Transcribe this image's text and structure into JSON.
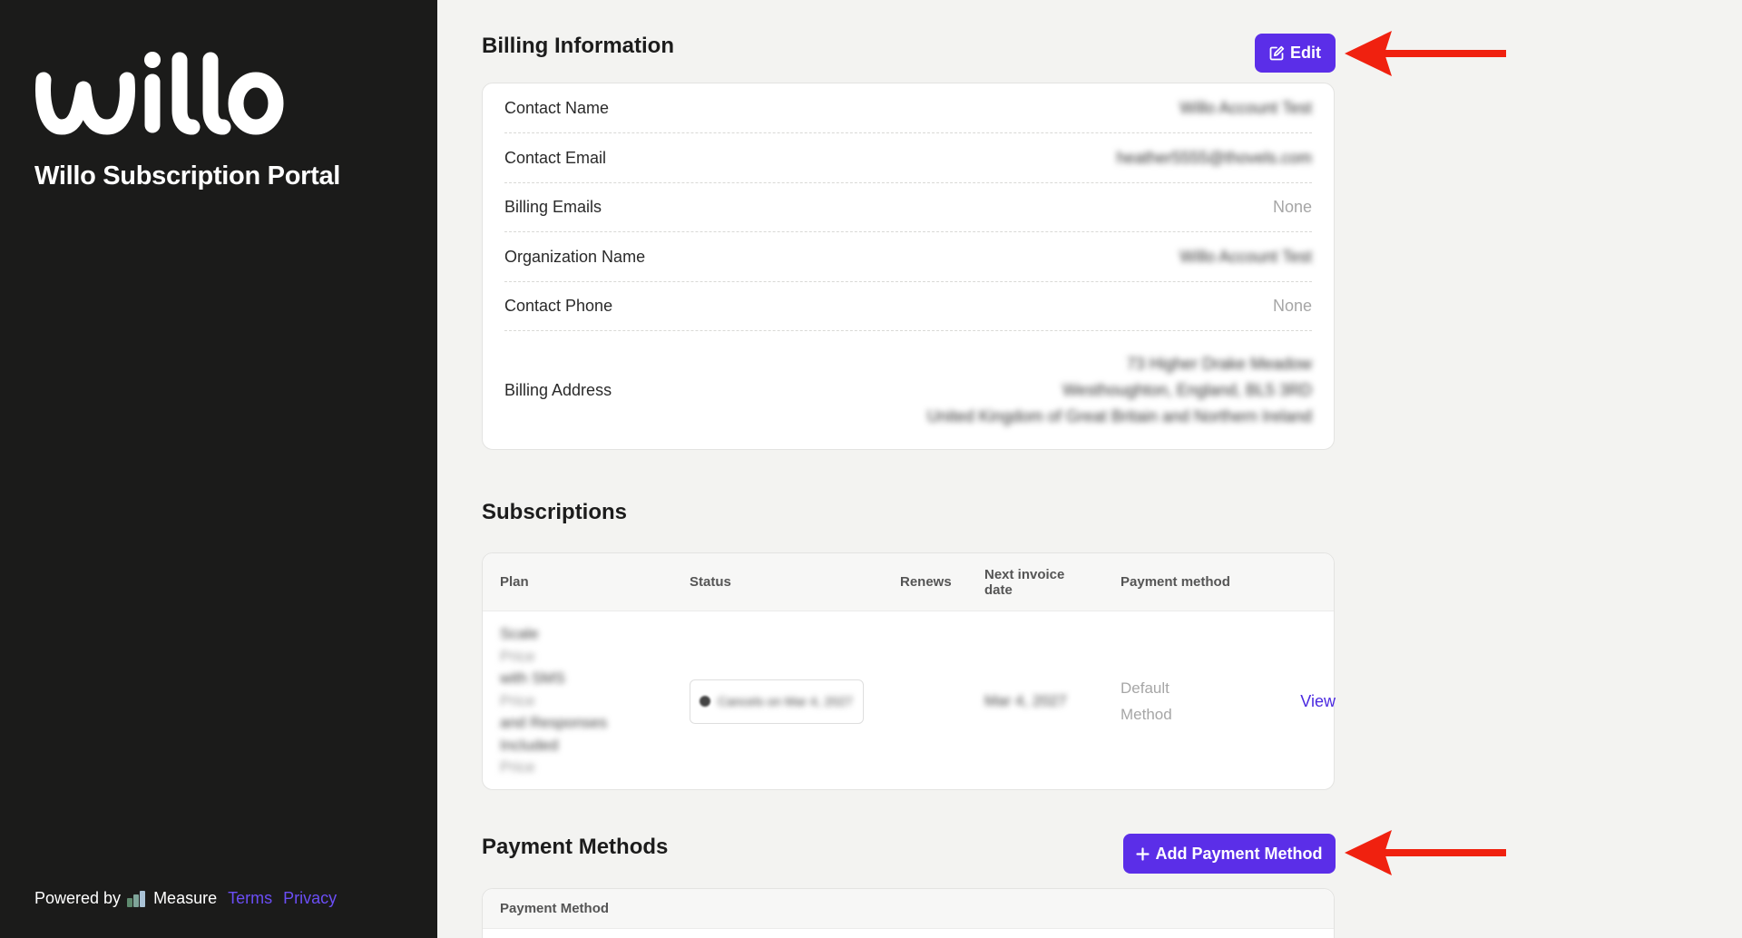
{
  "sidebar": {
    "logo_text": "willo",
    "portal_title": "Willo Subscription Portal",
    "footer": {
      "powered_by": "Powered by",
      "brand": "Measure",
      "terms": "Terms",
      "privacy": "Privacy"
    }
  },
  "billing": {
    "title": "Billing Information",
    "edit_label": "Edit",
    "rows": [
      {
        "label": "Contact Name",
        "value": "Willo Account Test"
      },
      {
        "label": "Contact Email",
        "value": "heather5555@thovels.com"
      },
      {
        "label": "Billing Emails",
        "value": "None"
      },
      {
        "label": "Organization Name",
        "value": "Willo Account Test"
      },
      {
        "label": "Contact Phone",
        "value": "None"
      }
    ],
    "address": {
      "label": "Billing Address",
      "lines": [
        "73 Higher Drake Meadow",
        "Westhoughton, England, BL5 3RD",
        "United Kingdom of Great Britain and Northern Ireland"
      ]
    }
  },
  "subscriptions": {
    "title": "Subscriptions",
    "headers": {
      "plan": "Plan",
      "status": "Status",
      "renews": "Renews",
      "next_invoice_1": "Next invoice",
      "next_invoice_2": "date",
      "payment_method": "Payment method"
    },
    "row": {
      "plan_lines": [
        "Scale",
        "Price",
        "with SMS",
        "Price",
        "and Responses",
        "Included",
        "Price"
      ],
      "status": "Cancels on Mar 4, 2027",
      "renews": "",
      "next_invoice": "Mar 4, 2027",
      "payment_1": "Default",
      "payment_2": "Method",
      "action": "View"
    }
  },
  "payment_methods": {
    "title": "Payment Methods",
    "add_label": "Add Payment Method",
    "column": "Payment Method"
  },
  "colors": {
    "accent": "#5b2ee8",
    "sidebar_bg": "#1b1b1a",
    "annotation_arrow": "#f0210f"
  }
}
